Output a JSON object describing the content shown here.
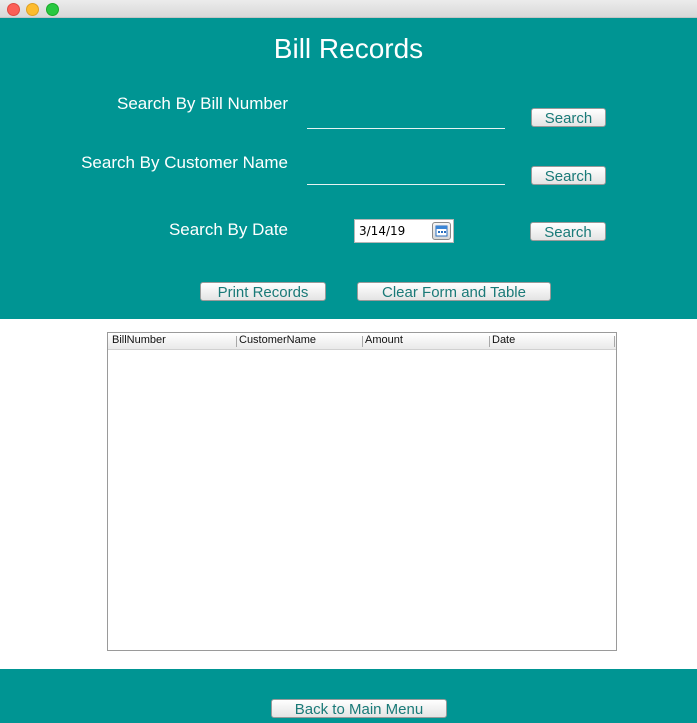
{
  "window": {
    "title": "Bill Records",
    "controls": [
      "close",
      "minimize",
      "zoom"
    ]
  },
  "search": {
    "bill_number_label": "Search By Bill Number",
    "bill_number_value": "",
    "customer_name_label": "Search By Customer Name",
    "customer_name_value": "",
    "date_label": "Search By Date",
    "date_value": "3/14/19",
    "search_button_label": "Search"
  },
  "actions": {
    "print_label": "Print Records",
    "clear_label": "Clear Form and Table"
  },
  "table": {
    "columns": [
      "BillNumber",
      "CustomerName",
      "Amount",
      "Date"
    ],
    "rows": []
  },
  "footer": {
    "back_label": "Back to Main Menu"
  },
  "colors": {
    "panel": "#009593",
    "button_text": "#1a7a78"
  }
}
